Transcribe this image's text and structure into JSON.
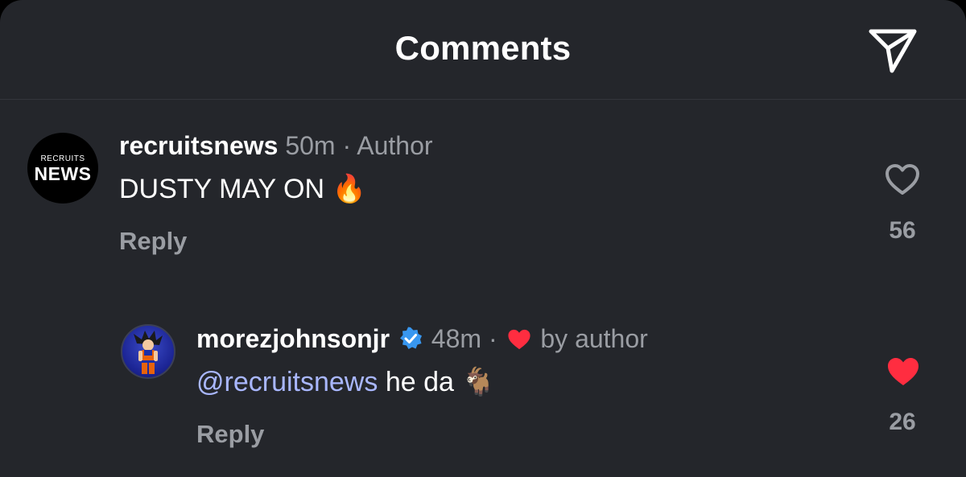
{
  "header": {
    "title": "Comments"
  },
  "icons": {
    "share": "paper-plane-icon",
    "like": "heart-outline-icon",
    "liked": "heart-filled-icon",
    "verified": "verified-badge-icon"
  },
  "colors": {
    "background": "#24262b",
    "like_red": "#ff2d40",
    "mention": "#a9b7ff",
    "verified": "#3897f0"
  },
  "comments": [
    {
      "username": "recruitsnews",
      "avatar_text_top": "RECRUITS",
      "avatar_text_bottom": "NEWS",
      "time": "50m",
      "separator": "·",
      "tag": "Author",
      "text": "DUSTY MAY ON",
      "emoji": "🔥",
      "reply_label": "Reply",
      "likes": "56",
      "liked": false
    },
    {
      "username": "morezjohnsonjr",
      "verified": true,
      "time": "48m",
      "separator": "·",
      "tag": "by author",
      "mention": "@recruitsnews",
      "text": "he da",
      "emoji": "🐐",
      "reply_label": "Reply",
      "likes": "26",
      "liked": true
    }
  ]
}
